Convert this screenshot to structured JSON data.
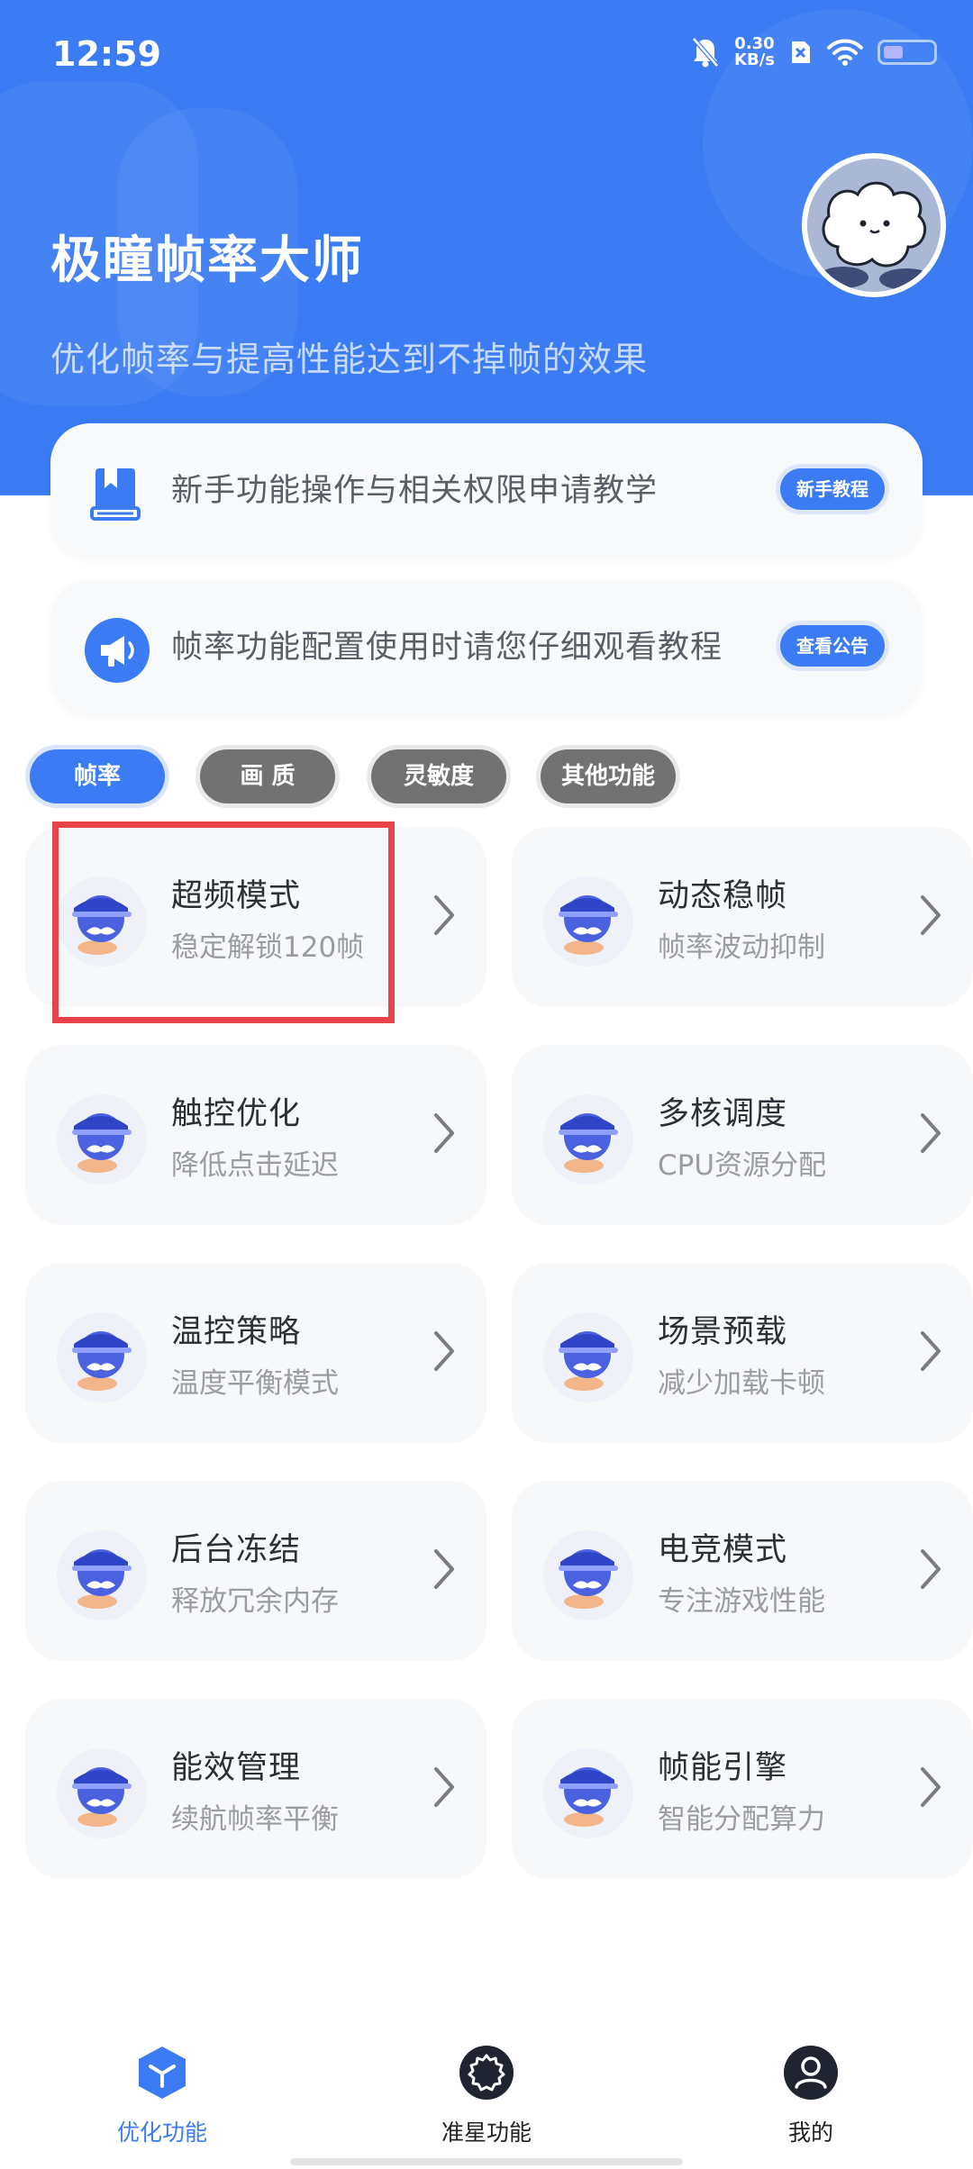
{
  "status_bar": {
    "time": "12:59",
    "net_speed_value": "0.30",
    "net_speed_unit": "KB/s",
    "battery_level": 0.4
  },
  "header": {
    "title": "极瞳帧率大师",
    "subtitle": "优化帧率与提高性能达到不掉帧的效果"
  },
  "notices": [
    {
      "text": "新手功能操作与相关权限申请教学",
      "button": "新手教程",
      "icon": "book-icon"
    },
    {
      "text": "帧率功能配置使用时请您仔细观看教程",
      "button": "查看公告",
      "icon": "megaphone-icon"
    }
  ],
  "tabs": [
    {
      "label": "帧率",
      "active": true
    },
    {
      "label": "画 质",
      "active": false
    },
    {
      "label": "灵敏度",
      "active": false
    },
    {
      "label": "其他功能",
      "active": false
    }
  ],
  "features": [
    {
      "title": "超频模式",
      "subtitle": "稳定解锁120帧"
    },
    {
      "title": "动态稳帧",
      "subtitle": "帧率波动抑制"
    },
    {
      "title": "触控优化",
      "subtitle": "降低点击延迟"
    },
    {
      "title": "多核调度",
      "subtitle": "CPU资源分配"
    },
    {
      "title": "温控策略",
      "subtitle": "温度平衡模式"
    },
    {
      "title": "场景预载",
      "subtitle": "减少加载卡顿"
    },
    {
      "title": "后台冻结",
      "subtitle": "释放冗余内存"
    },
    {
      "title": "电竞模式",
      "subtitle": "专注游戏性能"
    },
    {
      "title": "能效管理",
      "subtitle": "续航帧率平衡"
    },
    {
      "title": "帧能引擎",
      "subtitle": "智能分配算力"
    }
  ],
  "bottom_nav": [
    {
      "label": "优化功能",
      "icon": "cube-icon",
      "active": true
    },
    {
      "label": "准星功能",
      "icon": "gear-icon",
      "active": false
    },
    {
      "label": "我的",
      "icon": "user-icon",
      "active": false
    }
  ],
  "colors": {
    "primary": "#3b7cf4",
    "highlight": "#e9434a",
    "tab_inactive": "#727272"
  }
}
